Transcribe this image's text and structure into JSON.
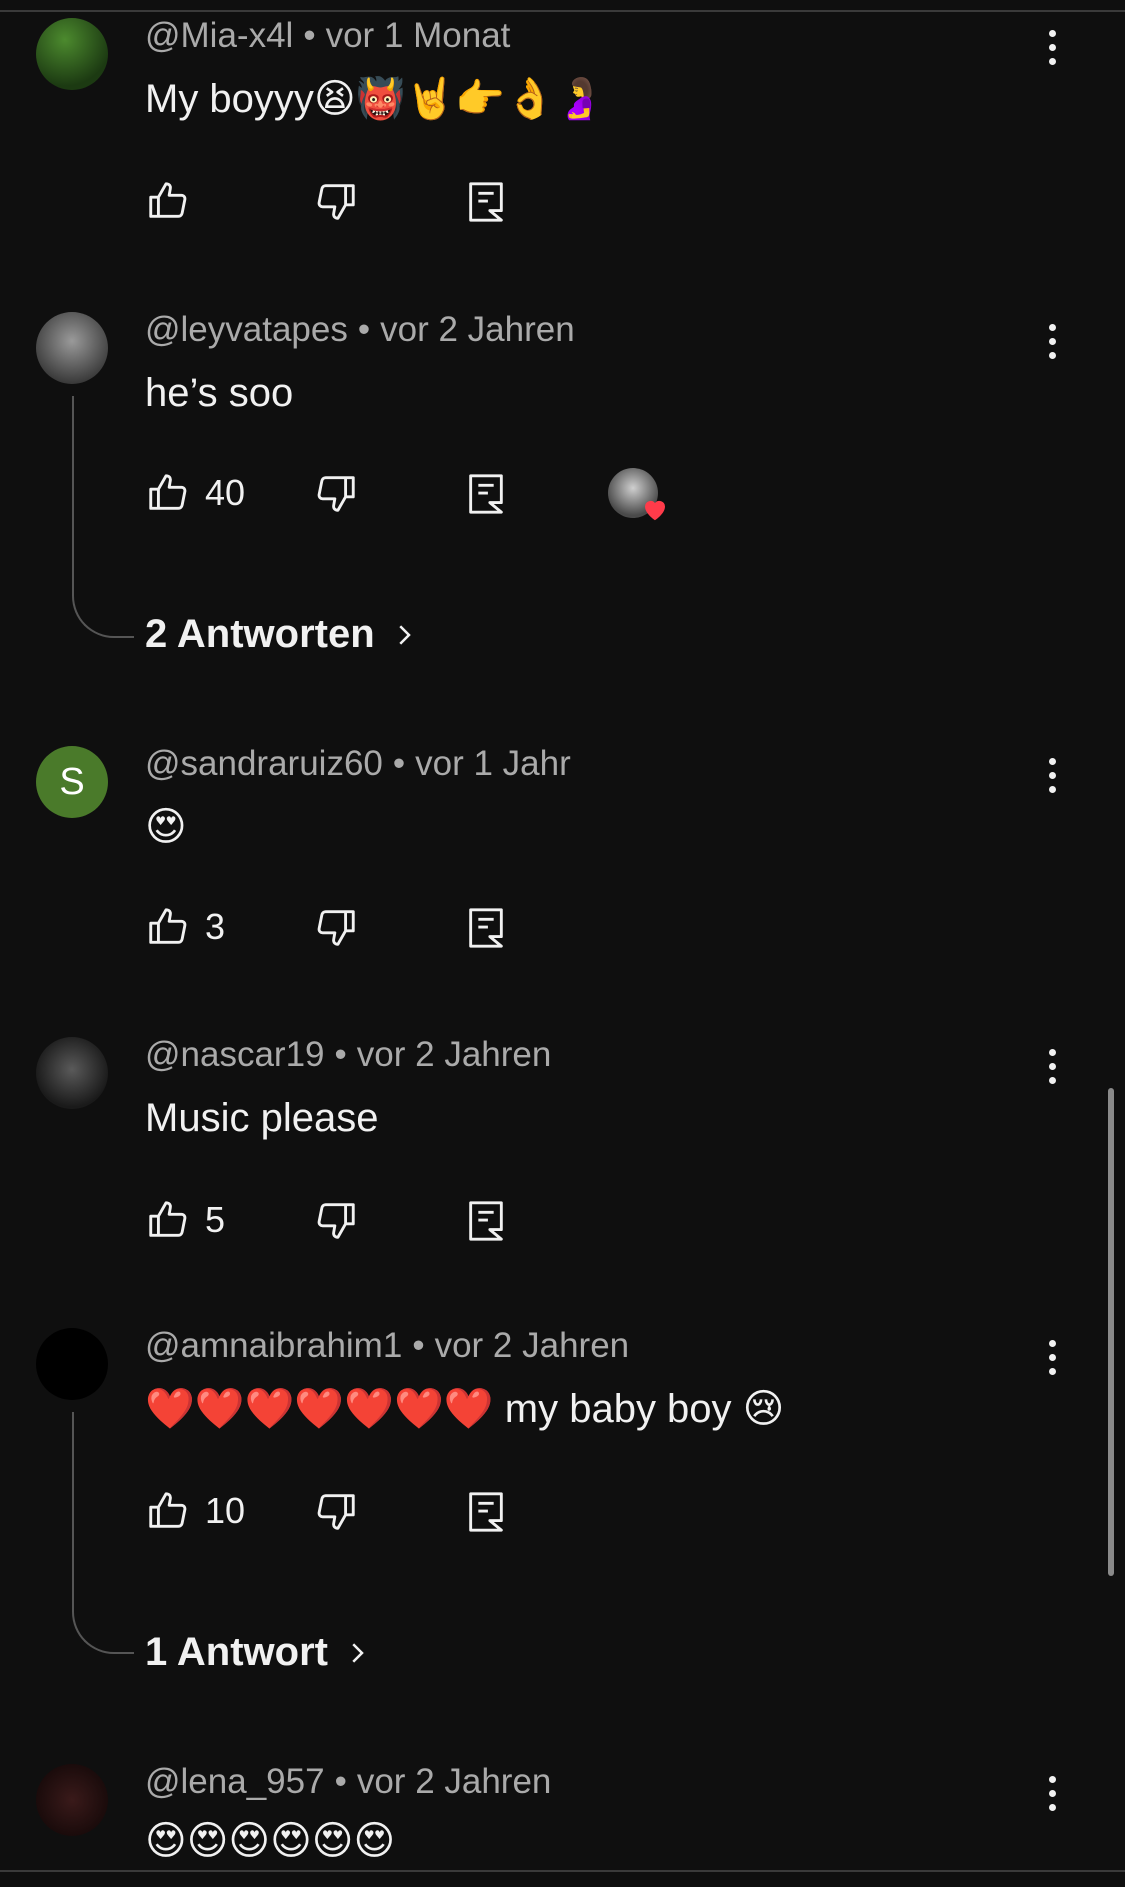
{
  "comments": [
    {
      "author": "@Mia-x4l",
      "time": "vor 1 Monat",
      "text": "My boyyy",
      "emojis": "😫👹🤘👉👌🤰",
      "likes": "",
      "avatar_color": "#2f5a1f"
    },
    {
      "author": "@leyvatapes",
      "time": "vor 2 Jahren",
      "text": "he’s soo",
      "emojis": "",
      "likes": "40",
      "avatar_color": "#6b6b6b",
      "replies": "2 Antworten",
      "creator_heart": true
    },
    {
      "author": "@sandraruiz60",
      "time": "vor 1 Jahr",
      "text": "",
      "emojis": "😍",
      "likes": "3",
      "avatar_color": "#4a7a2a",
      "avatar_letter": "S"
    },
    {
      "author": "@nascar19",
      "time": "vor 2 Jahren",
      "text": "Music please",
      "emojis": "",
      "likes": "5",
      "avatar_color": "#3a3a3a"
    },
    {
      "author": "@amnaibrahim1",
      "time": "vor 2 Jahren",
      "text": "my baby boy",
      "emojis_before": "❤️❤️❤️❤️❤️❤️❤️",
      "emojis": "😢",
      "likes": "10",
      "avatar_color": "#000000",
      "replies": "1 Antwort"
    },
    {
      "author": "@lena_957",
      "time": "vor 2 Jahren",
      "text": "",
      "emojis": "😍😍😍😍😍😍",
      "likes": "",
      "avatar_color": "#2a1515"
    }
  ],
  "icons": {
    "like": "thumbs-up-icon",
    "dislike": "thumbs-down-icon",
    "reply": "reply-icon",
    "more": "more-vert-icon",
    "chevron": "chevron-right-icon"
  }
}
